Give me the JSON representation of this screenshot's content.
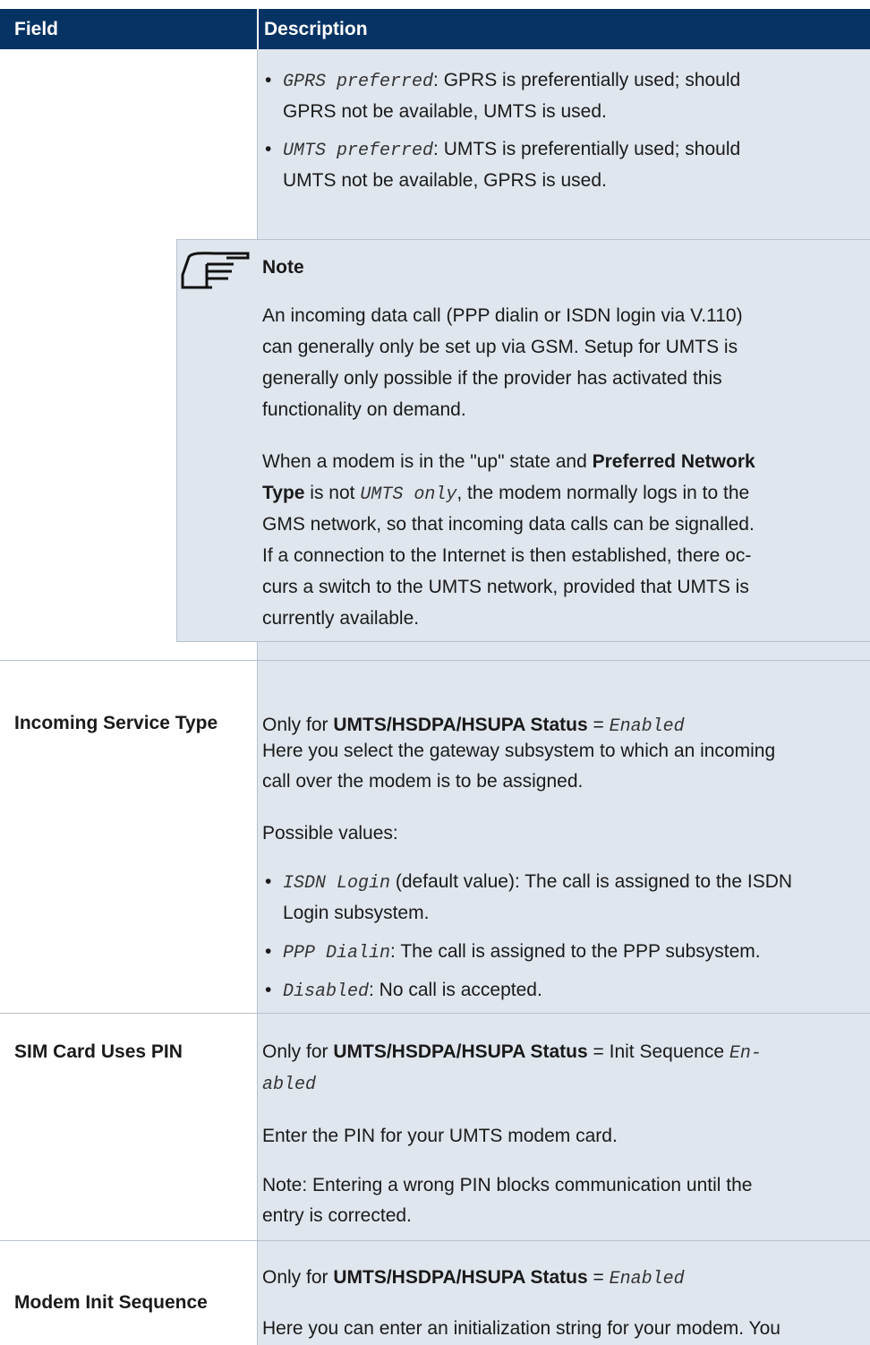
{
  "header": {
    "field": "Field",
    "description": "Description"
  },
  "preferred_network": {
    "bullets": [
      {
        "value": "GPRS preferred",
        "text": ": GPRS is preferentially used; should",
        "text2": "GPRS not be available, UMTS is used."
      },
      {
        "value": "UMTS preferred",
        "text": ": UMTS is preferentially used; should",
        "text2": "UMTS not be available, GPRS is used."
      }
    ]
  },
  "note": {
    "icon": "pointing-hand-icon",
    "title": "Note",
    "p1": [
      "An incoming data call (PPP dialin or ISDN login via V.110)",
      "can generally only be set up via GSM. Setup for UMTS is",
      "generally only possible if the provider has activated this",
      "functionality on demand."
    ],
    "p2_a": "When a modem is in the \"up\" state and ",
    "p2_bold1": "Preferred Network",
    "p2_bold2": "Type",
    "p2_b": " is not ",
    "p2_value": "UMTS only",
    "p2_c": ", the modem normally logs in to the",
    "p2_lines": [
      "GMS network, so that incoming data calls can be signalled.",
      "If a connection to the Internet is then established, there oc-",
      "curs a switch to the UMTS network, provided that UMTS is",
      "currently available."
    ]
  },
  "rows": {
    "incoming": {
      "field": "Incoming Service Type",
      "only_for": "Only for ",
      "status_label": "UMTS/HSDPA/HSUPA Status",
      "eq": " = ",
      "status_value": "Enabled",
      "desc1": "Here you select the gateway subsystem to which an incoming",
      "desc2": "call over the modem is to be assigned.",
      "possible": "Possible values:",
      "b1_value": "ISDN Login",
      "b1_text": " (default value): The call is assigned to the ISDN",
      "b1_text2": "Login subsystem.",
      "b2_value": "PPP Dialin",
      "b2_text": ": The call is assigned to the PPP subsystem.",
      "b3_value": "Disabled",
      "b3_text": ": No call is accepted."
    },
    "sim": {
      "field": "SIM Card Uses PIN",
      "only_for": "Only for ",
      "status_label": "UMTS/HSDPA/HSUPA Status",
      "eq": " = Init Sequence ",
      "status_value1": "En-",
      "status_value2": "abled",
      "desc1": "Enter the PIN for your UMTS modem card.",
      "note1": "Note: Entering a wrong PIN blocks communication until the",
      "note2": "entry is corrected."
    },
    "modem": {
      "field": "Modem Init Sequence",
      "only_for": "Only for ",
      "status_label": "UMTS/HSDPA/HSUPA Status",
      "eq": " = ",
      "status_value": "Enabled",
      "desc1": "Here you can enter an initialization string for your modem. You"
    }
  }
}
